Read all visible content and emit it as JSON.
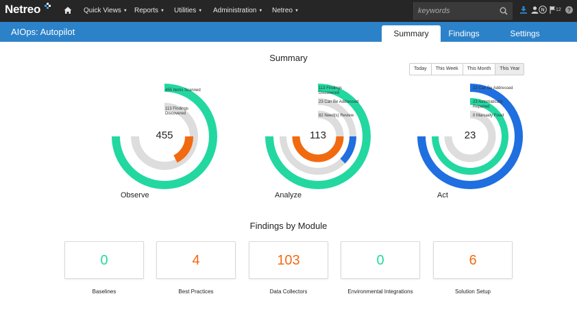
{
  "brand": {
    "logo": "Netreo"
  },
  "nav": {
    "items": [
      "Quick Views",
      "Reports",
      "Utilities",
      "Administration",
      "Netreo"
    ],
    "search_placeholder": "keywords",
    "flag_count": "12"
  },
  "page": {
    "title": "AIOps: Autopilot",
    "tabs": [
      "Summary",
      "Findings",
      "Settings"
    ],
    "active_tab": "Summary"
  },
  "summary": {
    "heading": "Summary",
    "ranges": [
      "Today",
      "This Week",
      "This Month",
      "This Year"
    ],
    "selected_range": "This Year",
    "colors": {
      "green": "#22d8a0",
      "orange": "#f26a10",
      "blue": "#1f6fe0",
      "grey": "#dddddd"
    },
    "observe": {
      "label": "Observe",
      "center": "455",
      "legend": [
        "455 Items Scanned",
        "113 Findings Discovered"
      ]
    },
    "analyze": {
      "label": "Analyze",
      "center": "113",
      "legend": [
        "113 Findings Discovered",
        "23 Can Be Addressed",
        "82 Need(s) Review"
      ]
    },
    "act": {
      "label": "Act",
      "center": "23",
      "legend": [
        "23 Can Be Addressed",
        "23 Automatically Repaired",
        "0 Manually Fixed"
      ]
    }
  },
  "findings_by_module": {
    "heading": "Findings by Module",
    "modules": [
      {
        "value": "0",
        "label": "Baselines",
        "color": "#22d8a0"
      },
      {
        "value": "4",
        "label": "Best Practices",
        "color": "#f26a10"
      },
      {
        "value": "103",
        "label": "Data Collectors",
        "color": "#f26a10"
      },
      {
        "value": "0",
        "label": "Environmental Integrations",
        "color": "#22d8a0"
      },
      {
        "value": "6",
        "label": "Solution Setup",
        "color": "#f26a10"
      }
    ]
  }
}
